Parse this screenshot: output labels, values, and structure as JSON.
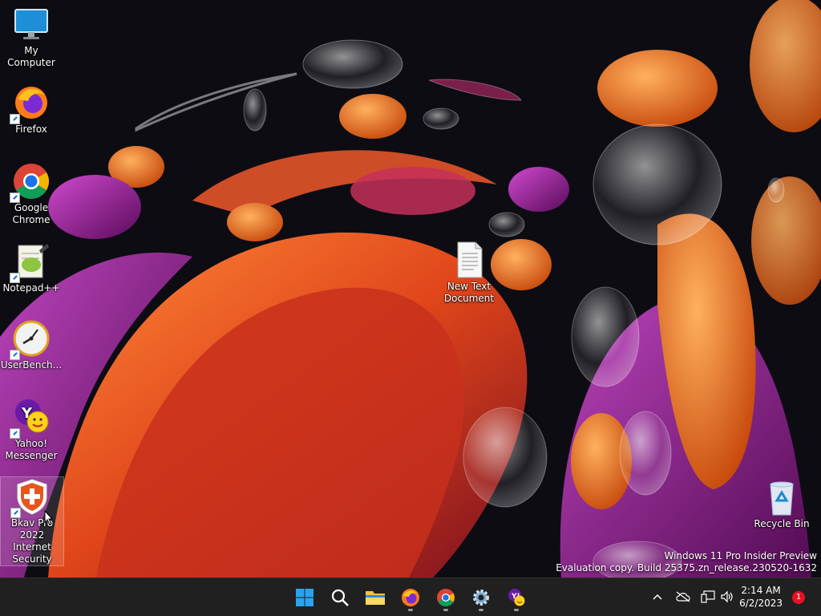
{
  "desktop": {
    "icons": [
      {
        "label": "My Computer",
        "icon": "monitor-icon"
      },
      {
        "label": "Firefox",
        "icon": "firefox-icon"
      },
      {
        "label": "Google Chrome",
        "icon": "chrome-icon"
      },
      {
        "label": "Notepad++",
        "icon": "notepadpp-icon"
      },
      {
        "label": "UserBench...",
        "icon": "userbenchmark-icon"
      },
      {
        "label": "Yahoo! Messenger",
        "icon": "yahoo-messenger-icon"
      },
      {
        "label": "Bkav Pro 2022 Internet Security",
        "icon": "bkav-shield-icon"
      },
      {
        "label": "New Text Document",
        "icon": "text-document-icon"
      },
      {
        "label": "Recycle Bin",
        "icon": "recycle-bin-icon"
      }
    ],
    "watermark": {
      "line1": "Windows 11 Pro Insider Preview",
      "line2": "Evaluation copy. Build 25375.zn_release.230520-1632"
    }
  },
  "taskbar": {
    "apps": [
      "start-icon",
      "search-icon",
      "file-explorer-icon",
      "firefox-icon",
      "chrome-icon",
      "settings-icon",
      "yahoo-messenger-icon"
    ],
    "tray": {
      "clock_time": "2:14 AM",
      "clock_date": "6/2/2023",
      "notification_count": "1"
    }
  },
  "colors": {
    "taskbar": "#202020",
    "start_blue": "#0078d4",
    "badge": "#e81123"
  }
}
